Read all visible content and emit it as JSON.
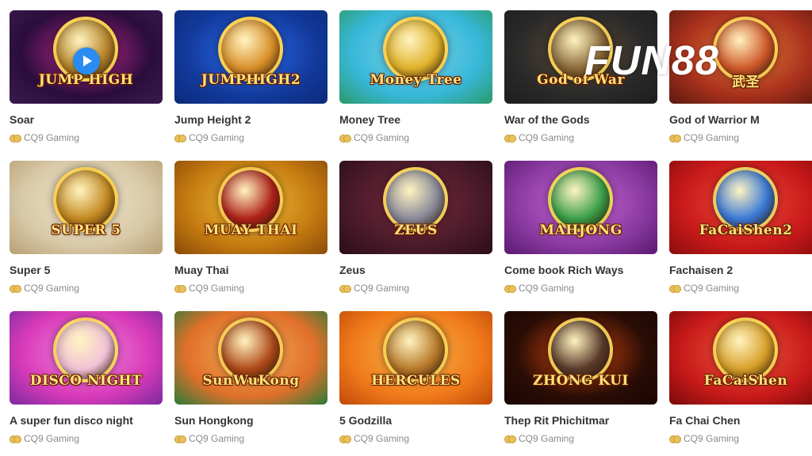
{
  "watermark": "FUN88",
  "games": [
    {
      "title": "Soar",
      "provider": "CQ9 Gaming",
      "art_label": "JUMP HIGH",
      "colors": [
        "#2b0d3d",
        "#c42a8c",
        "#3a1a4d"
      ],
      "emblem": "#b8862b",
      "play_icon": true
    },
    {
      "title": "Jump Height 2",
      "provider": "CQ9 Gaming",
      "art_label": "JUMPHIGH2",
      "colors": [
        "#123a9c",
        "#2f6ff0",
        "#0b2a7a"
      ],
      "emblem": "#d9902a"
    },
    {
      "title": "Money Tree",
      "provider": "CQ9 Gaming",
      "art_label": "Money Tree",
      "colors": [
        "#38b7d8",
        "#7ad4ea",
        "#2a9a6a"
      ],
      "emblem": "#e0b32c"
    },
    {
      "title": "War of the Gods",
      "provider": "CQ9 Gaming",
      "art_label": "God of War",
      "colors": [
        "#2a2a2a",
        "#5e4a35",
        "#1c1c1c"
      ],
      "emblem": "#8a6a3a"
    },
    {
      "title": "God of Warrior M",
      "provider": "CQ9 Gaming",
      "art_label": "武圣",
      "colors": [
        "#a8301c",
        "#e27a3a",
        "#5a1a10"
      ],
      "emblem": "#d0582a"
    },
    {
      "title": "Super 5",
      "provider": "CQ9 Gaming",
      "art_label": "SUPER 5",
      "colors": [
        "#d8c9a8",
        "#efe3c9",
        "#b89f74"
      ],
      "emblem": "#c48a22"
    },
    {
      "title": "Muay Thai",
      "provider": "CQ9 Gaming",
      "art_label": "MUAY THAI",
      "colors": [
        "#c47a10",
        "#f2c23a",
        "#8a4a08"
      ],
      "emblem": "#b0221a"
    },
    {
      "title": "Zeus",
      "provider": "CQ9 Gaming",
      "art_label": "ZEUS",
      "colors": [
        "#4a1a2a",
        "#7a2a3a",
        "#2a0d18"
      ],
      "emblem": "#8a8a9a"
    },
    {
      "title": "Come book Rich Ways",
      "provider": "CQ9 Gaming",
      "art_label": "MAHJONG",
      "colors": [
        "#8a3aa0",
        "#c86ad8",
        "#5a1a70"
      ],
      "emblem": "#3aa04a"
    },
    {
      "title": "Fachaisen 2",
      "provider": "CQ9 Gaming",
      "art_label": "FaCaiShen2",
      "colors": [
        "#c81a1a",
        "#ee4a3a",
        "#8a0d0d"
      ],
      "emblem": "#3a7ad8"
    },
    {
      "title": "A super fun disco night",
      "provider": "CQ9 Gaming",
      "art_label": "DISCO NIGHT",
      "colors": [
        "#d83ab8",
        "#f28ae0",
        "#7a2aa0"
      ],
      "emblem": "#f2c2d8"
    },
    {
      "title": "Sun Hongkong",
      "provider": "CQ9 Gaming",
      "art_label": "SunWuKong",
      "colors": [
        "#e0702a",
        "#f5b05a",
        "#2a7a3a"
      ],
      "emblem": "#b04a1a"
    },
    {
      "title": "5 Godzilla",
      "provider": "CQ9 Gaming",
      "art_label": "HERCULES",
      "colors": [
        "#f07a1a",
        "#f8b84a",
        "#c24a0a"
      ],
      "emblem": "#b87a2a"
    },
    {
      "title": "Thep Rit Phichitmar",
      "provider": "CQ9 Gaming",
      "art_label": "ZHONG KUI",
      "colors": [
        "#2a0d05",
        "#d84a10",
        "#1a0502"
      ],
      "emblem": "#5a3a2a"
    },
    {
      "title": "Fa Chai Chen",
      "provider": "CQ9 Gaming",
      "art_label": "FaCaiShen",
      "colors": [
        "#c81a1a",
        "#ee5a3a",
        "#7a0a0a"
      ],
      "emblem": "#d8a02a"
    }
  ]
}
